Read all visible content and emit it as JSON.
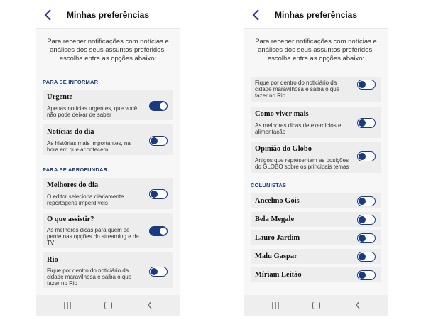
{
  "screens": [
    {
      "header_title": "Minhas preferências",
      "intro_lines": [
        "Para receber notificações com notícias e",
        "análises dos seus assuntos preferidos,",
        "escolha entre as opções abaixo:"
      ],
      "sections": [
        {
          "label": "PARA SE INFORMAR",
          "items": [
            {
              "title": "Urgente",
              "desc": [
                "Apenas notícias urgentes, que você",
                "não pode deixar de saber"
              ],
              "enabled": true
            },
            {
              "title": "Notícias do dia",
              "desc": [
                "As histórias mais importantes, na",
                "hora em que acontecem."
              ],
              "enabled": false
            }
          ]
        },
        {
          "label": "PARA SE APROFUNDAR",
          "items": [
            {
              "title": "Melhores do dia",
              "desc": [
                "O editor seleciona diariamente",
                "reportagens imperdíveis"
              ],
              "enabled": false
            },
            {
              "title": "O que assistir?",
              "desc": [
                "As melhores dicas para quem se",
                "perde nas opções do streaming e da",
                "TV"
              ],
              "enabled": true
            },
            {
              "title": "Rio",
              "desc": [
                "Fique por dentro do noticiário da",
                "cidade maravilhosa e saiba o que",
                "fazer no Rio"
              ],
              "enabled": false
            }
          ]
        }
      ]
    },
    {
      "header_title": "Minhas preferências",
      "intro_lines": [
        "Para receber notificações com notícias e",
        "análises dos seus assuntos preferidos,",
        "escolha entre as opções abaixo:"
      ],
      "items": [
        {
          "title": "",
          "desc": [
            "Fique por dentro do noticiário da",
            "cidade maravilhosa e saiba o que",
            "fazer no Rio"
          ],
          "enabled": false
        },
        {
          "title": "Como viver mais",
          "desc": [
            "As melhores dicas de exercícios e",
            "alimentação"
          ],
          "enabled": false
        },
        {
          "title": "Opinião do Globo",
          "desc": [
            "Artigos que representam as posições",
            "do GLOBO sobre os principais temas"
          ],
          "enabled": false
        }
      ],
      "columnists_label": "COLUNISTAS",
      "columnists": [
        {
          "title": "Ancelmo Gois",
          "enabled": false
        },
        {
          "title": "Bela Megale",
          "enabled": false
        },
        {
          "title": "Lauro Jardim",
          "enabled": false
        },
        {
          "title": "Malu Gaspar",
          "enabled": false
        },
        {
          "title": "Míriam Leitão",
          "enabled": false
        }
      ]
    }
  ],
  "colors": {
    "accent": "#1a3c7e",
    "card": "#ededed",
    "screen_bg": "#f7f7f7"
  },
  "icons": {
    "back": "chevron-left-icon",
    "nav_recent": "recent-apps-icon",
    "nav_home": "home-icon",
    "nav_back": "nav-back-icon"
  }
}
